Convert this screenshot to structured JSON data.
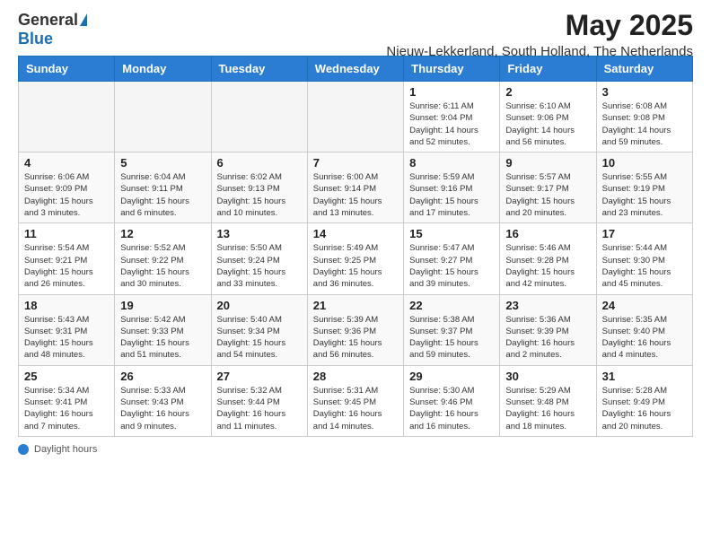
{
  "header": {
    "logo_general": "General",
    "logo_blue": "Blue",
    "title": "May 2025",
    "subtitle": "Nieuw-Lekkerland, South Holland, The Netherlands"
  },
  "footer": {
    "label": "Daylight hours"
  },
  "days_of_week": [
    "Sunday",
    "Monday",
    "Tuesday",
    "Wednesday",
    "Thursday",
    "Friday",
    "Saturday"
  ],
  "weeks": [
    [
      {
        "day": "",
        "info": ""
      },
      {
        "day": "",
        "info": ""
      },
      {
        "day": "",
        "info": ""
      },
      {
        "day": "",
        "info": ""
      },
      {
        "day": "1",
        "info": "Sunrise: 6:11 AM\nSunset: 9:04 PM\nDaylight: 14 hours\nand 52 minutes."
      },
      {
        "day": "2",
        "info": "Sunrise: 6:10 AM\nSunset: 9:06 PM\nDaylight: 14 hours\nand 56 minutes."
      },
      {
        "day": "3",
        "info": "Sunrise: 6:08 AM\nSunset: 9:08 PM\nDaylight: 14 hours\nand 59 minutes."
      }
    ],
    [
      {
        "day": "4",
        "info": "Sunrise: 6:06 AM\nSunset: 9:09 PM\nDaylight: 15 hours\nand 3 minutes."
      },
      {
        "day": "5",
        "info": "Sunrise: 6:04 AM\nSunset: 9:11 PM\nDaylight: 15 hours\nand 6 minutes."
      },
      {
        "day": "6",
        "info": "Sunrise: 6:02 AM\nSunset: 9:13 PM\nDaylight: 15 hours\nand 10 minutes."
      },
      {
        "day": "7",
        "info": "Sunrise: 6:00 AM\nSunset: 9:14 PM\nDaylight: 15 hours\nand 13 minutes."
      },
      {
        "day": "8",
        "info": "Sunrise: 5:59 AM\nSunset: 9:16 PM\nDaylight: 15 hours\nand 17 minutes."
      },
      {
        "day": "9",
        "info": "Sunrise: 5:57 AM\nSunset: 9:17 PM\nDaylight: 15 hours\nand 20 minutes."
      },
      {
        "day": "10",
        "info": "Sunrise: 5:55 AM\nSunset: 9:19 PM\nDaylight: 15 hours\nand 23 minutes."
      }
    ],
    [
      {
        "day": "11",
        "info": "Sunrise: 5:54 AM\nSunset: 9:21 PM\nDaylight: 15 hours\nand 26 minutes."
      },
      {
        "day": "12",
        "info": "Sunrise: 5:52 AM\nSunset: 9:22 PM\nDaylight: 15 hours\nand 30 minutes."
      },
      {
        "day": "13",
        "info": "Sunrise: 5:50 AM\nSunset: 9:24 PM\nDaylight: 15 hours\nand 33 minutes."
      },
      {
        "day": "14",
        "info": "Sunrise: 5:49 AM\nSunset: 9:25 PM\nDaylight: 15 hours\nand 36 minutes."
      },
      {
        "day": "15",
        "info": "Sunrise: 5:47 AM\nSunset: 9:27 PM\nDaylight: 15 hours\nand 39 minutes."
      },
      {
        "day": "16",
        "info": "Sunrise: 5:46 AM\nSunset: 9:28 PM\nDaylight: 15 hours\nand 42 minutes."
      },
      {
        "day": "17",
        "info": "Sunrise: 5:44 AM\nSunset: 9:30 PM\nDaylight: 15 hours\nand 45 minutes."
      }
    ],
    [
      {
        "day": "18",
        "info": "Sunrise: 5:43 AM\nSunset: 9:31 PM\nDaylight: 15 hours\nand 48 minutes."
      },
      {
        "day": "19",
        "info": "Sunrise: 5:42 AM\nSunset: 9:33 PM\nDaylight: 15 hours\nand 51 minutes."
      },
      {
        "day": "20",
        "info": "Sunrise: 5:40 AM\nSunset: 9:34 PM\nDaylight: 15 hours\nand 54 minutes."
      },
      {
        "day": "21",
        "info": "Sunrise: 5:39 AM\nSunset: 9:36 PM\nDaylight: 15 hours\nand 56 minutes."
      },
      {
        "day": "22",
        "info": "Sunrise: 5:38 AM\nSunset: 9:37 PM\nDaylight: 15 hours\nand 59 minutes."
      },
      {
        "day": "23",
        "info": "Sunrise: 5:36 AM\nSunset: 9:39 PM\nDaylight: 16 hours\nand 2 minutes."
      },
      {
        "day": "24",
        "info": "Sunrise: 5:35 AM\nSunset: 9:40 PM\nDaylight: 16 hours\nand 4 minutes."
      }
    ],
    [
      {
        "day": "25",
        "info": "Sunrise: 5:34 AM\nSunset: 9:41 PM\nDaylight: 16 hours\nand 7 minutes."
      },
      {
        "day": "26",
        "info": "Sunrise: 5:33 AM\nSunset: 9:43 PM\nDaylight: 16 hours\nand 9 minutes."
      },
      {
        "day": "27",
        "info": "Sunrise: 5:32 AM\nSunset: 9:44 PM\nDaylight: 16 hours\nand 11 minutes."
      },
      {
        "day": "28",
        "info": "Sunrise: 5:31 AM\nSunset: 9:45 PM\nDaylight: 16 hours\nand 14 minutes."
      },
      {
        "day": "29",
        "info": "Sunrise: 5:30 AM\nSunset: 9:46 PM\nDaylight: 16 hours\nand 16 minutes."
      },
      {
        "day": "30",
        "info": "Sunrise: 5:29 AM\nSunset: 9:48 PM\nDaylight: 16 hours\nand 18 minutes."
      },
      {
        "day": "31",
        "info": "Sunrise: 5:28 AM\nSunset: 9:49 PM\nDaylight: 16 hours\nand 20 minutes."
      }
    ]
  ]
}
